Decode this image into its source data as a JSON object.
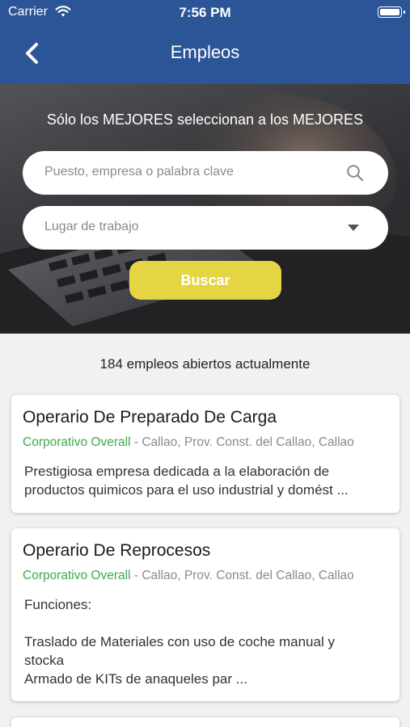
{
  "status_bar": {
    "carrier": "Carrier",
    "time": "7:56 PM",
    "icons": [
      "wifi-icon",
      "battery-icon"
    ]
  },
  "nav": {
    "title": "Empleos",
    "back_icon": "chevron-left-icon"
  },
  "hero": {
    "tagline": "Sólo los MEJORES seleccionan a los MEJORES",
    "search": {
      "placeholder": "Puesto, empresa o palabra clave",
      "value": "",
      "icon": "search-icon"
    },
    "location": {
      "placeholder": "Lugar de trabajo",
      "value": "",
      "icon": "dropdown-icon"
    },
    "search_button": "Buscar",
    "colors": {
      "header": "#2c5597",
      "button": "#e5d545"
    }
  },
  "jobs": {
    "count_text": "184 empleos abiertos actualmente",
    "items": [
      {
        "title": "Operario De Preparado De Carga",
        "company": "Corporativo Overall",
        "separator": " - ",
        "location": "Callao, Prov. Const. del Callao, Callao",
        "desc_lines": [
          "Prestigiosa empresa dedicada a la elaboración de",
          "productos quimicos para el uso industrial y domést ..."
        ]
      },
      {
        "title": "Operario De Reprocesos",
        "company": "Corporativo Overall",
        "separator": " - ",
        "location": "Callao, Prov. Const. del Callao, Callao",
        "desc_lines": [
          "Funciones:",
          "",
          "Traslado de Materiales con uso de coche manual y",
          "stocka",
          "Armado de KITs de anaqueles par ..."
        ]
      }
    ],
    "colors": {
      "company": "#3caa4a"
    }
  }
}
